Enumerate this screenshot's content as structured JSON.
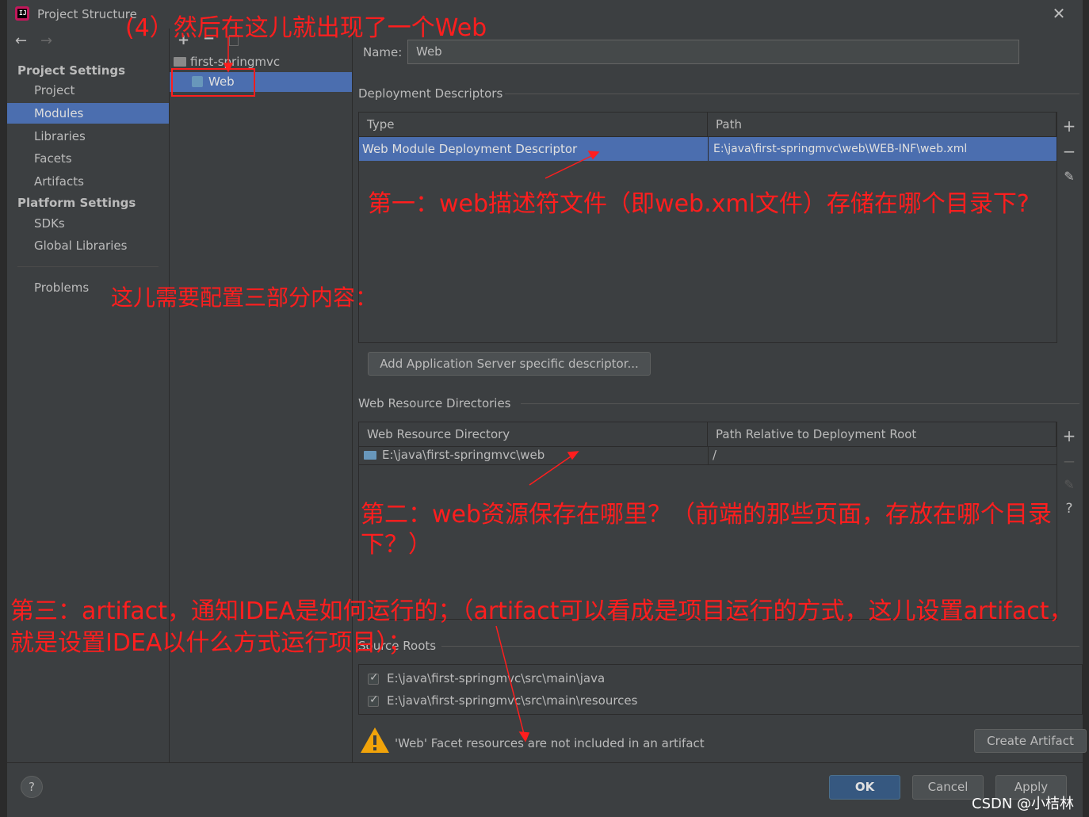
{
  "window": {
    "title": "Project Structure"
  },
  "left_nav": {
    "project_settings_header": "Project Settings",
    "project_items": [
      {
        "label": "Project",
        "selected": false
      },
      {
        "label": "Modules",
        "selected": true
      },
      {
        "label": "Libraries",
        "selected": false
      },
      {
        "label": "Facets",
        "selected": false
      },
      {
        "label": "Artifacts",
        "selected": false
      }
    ],
    "platform_settings_header": "Platform Settings",
    "platform_items": [
      {
        "label": "SDKs"
      },
      {
        "label": "Global Libraries"
      }
    ],
    "problems_label": "Problems"
  },
  "module_tree": {
    "module_name": "first-springmvc",
    "facet_name": "Web"
  },
  "facet": {
    "name_label": "Name:",
    "name_value": "Web",
    "deployment_descriptors_title": "Deployment Descriptors",
    "dd_columns": [
      "Type",
      "Path"
    ],
    "dd_rows": [
      {
        "type": "Web Module Deployment Descriptor",
        "path": "E:\\java\\first-springmvc\\web\\WEB-INF\\web.xml"
      }
    ],
    "add_server_descriptor_button": "Add Application Server specific descriptor...",
    "web_resource_dirs_title": "Web Resource Directories",
    "wr_columns": [
      "Web Resource Directory",
      "Path Relative to Deployment Root"
    ],
    "wr_rows": [
      {
        "dir": "E:\\java\\first-springmvc\\web",
        "relative": "/"
      }
    ],
    "source_roots_title": "Source Roots",
    "source_roots": [
      {
        "path": "E:\\java\\first-springmvc\\src\\main\\java",
        "checked": true
      },
      {
        "path": "E:\\java\\first-springmvc\\src\\main\\resources",
        "checked": true
      }
    ],
    "warning_text": "'Web' Facet resources are not included in an artifact",
    "create_artifact_button": "Create Artifact"
  },
  "dialog_buttons": {
    "ok": "OK",
    "cancel": "Cancel",
    "apply": "Apply",
    "help": "?"
  },
  "annotations": {
    "step4": "(4）然后在这儿就出现了一个Web",
    "configure_three": "这儿需要配置三部分内容：",
    "first": "第一：web描述符文件（即web.xml文件）存储在哪个目录下?",
    "second_line1": "第二：web资源保存在哪里？（前端的那些页面，存放在哪个目录",
    "second_line2": "下？）",
    "third_line1": "第三：artifact，通知IDEA是如何运行的；（artifact可以看成是项目运行的方式，这儿设置artifact，",
    "third_line2": "就是设置IDEA以什么方式运行项目）；"
  },
  "watermark": "CSDN @小桔林",
  "colors": {
    "selection": "#4b6eaf",
    "annotation": "#ff1e1e",
    "warning": "#f0a30a"
  }
}
